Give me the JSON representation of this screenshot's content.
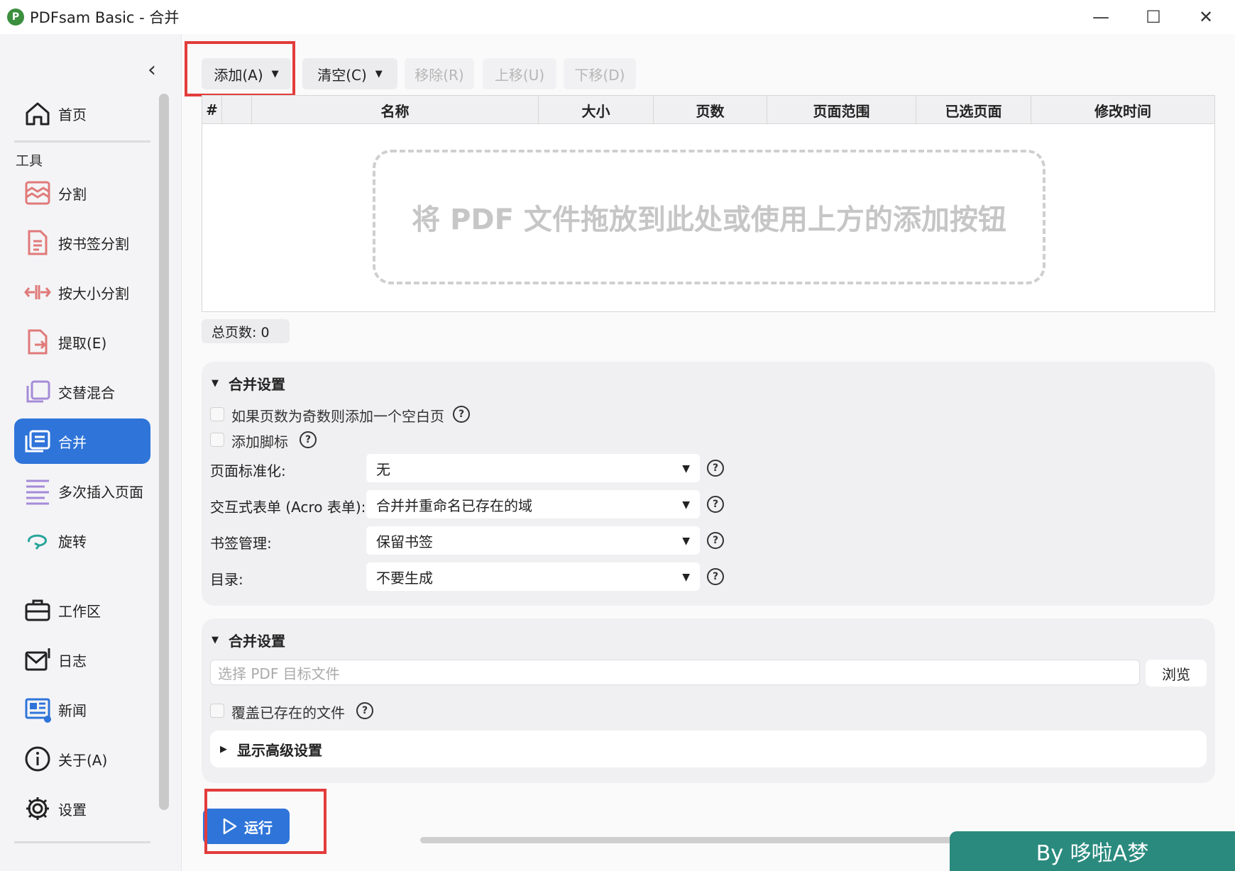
{
  "window": {
    "title": "PDFsam Basic - 合并",
    "minimize": "—",
    "maximize": "☐",
    "close": "✕"
  },
  "sidebar": {
    "collapse": "‹",
    "home": "首页",
    "section_label": "工具",
    "items": [
      {
        "label": "分割",
        "icon": "split-icon"
      },
      {
        "label": "按书签分割",
        "icon": "bookmark-split-icon"
      },
      {
        "label": "按大小分割",
        "icon": "size-split-icon"
      },
      {
        "label": "提取(E)",
        "icon": "extract-icon"
      },
      {
        "label": "交替混合",
        "icon": "alternate-mix-icon"
      },
      {
        "label": "合并",
        "icon": "merge-icon",
        "active": true
      },
      {
        "label": "多次插入页面",
        "icon": "insert-pages-icon"
      },
      {
        "label": "旋转",
        "icon": "rotate-icon"
      }
    ],
    "bottom": [
      {
        "label": "工作区",
        "icon": "workspace-icon"
      },
      {
        "label": "日志",
        "icon": "log-icon"
      },
      {
        "label": "新闻",
        "icon": "news-icon"
      },
      {
        "label": "关于(A)",
        "icon": "info-icon"
      },
      {
        "label": "设置",
        "icon": "gear-icon"
      }
    ]
  },
  "toolbar": {
    "add": "添加(A)",
    "clear": "清空(C)",
    "remove": "移除(R)",
    "move_up": "上移(U)",
    "move_down": "下移(D)"
  },
  "table": {
    "columns": [
      "#",
      "",
      "名称",
      "大小",
      "页数",
      "页面范围",
      "已选页面",
      "修改时间"
    ],
    "placeholder": "将 PDF 文件拖放到此处或使用上方的添加按钮",
    "total": "总页数: 0"
  },
  "merge_settings": {
    "title": "合并设置",
    "blank_page": "如果页数为奇数则添加一个空白页",
    "footer": "添加脚标",
    "normalize_label": "页面标准化:",
    "normalize_value": "无",
    "acroform_label": "交互式表单 (Acro 表单):",
    "acroform_value": "合并并重命名已存在的域",
    "bookmarks_label": "书签管理:",
    "bookmarks_value": "保留书签",
    "toc_label": "目录:",
    "toc_value": "不要生成"
  },
  "output_settings": {
    "title": "合并设置",
    "destination_placeholder": "选择 PDF 目标文件",
    "browse": "浏览",
    "overwrite": "覆盖已存在的文件",
    "advanced": "显示高级设置"
  },
  "run": "运行",
  "watermark": "By 哆啦A梦",
  "colors": {
    "accent": "#2f74d9",
    "highlight": "#e33c3c",
    "tool_icon": "#e07a7a",
    "watermark": "#2a8a7e"
  }
}
